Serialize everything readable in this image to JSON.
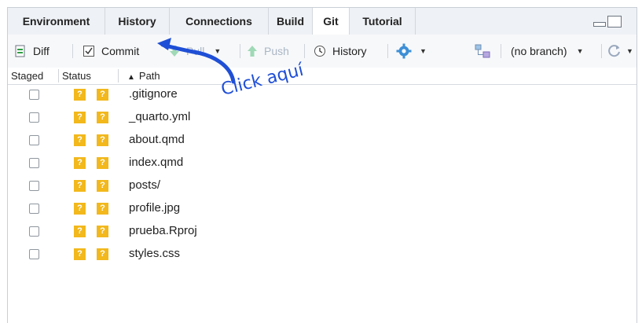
{
  "tabs": [
    {
      "label": "Environment",
      "active": false
    },
    {
      "label": "History",
      "active": false
    },
    {
      "label": "Connections",
      "active": false
    },
    {
      "label": "Build",
      "active": false
    },
    {
      "label": "Git",
      "active": true
    },
    {
      "label": "Tutorial",
      "active": false
    }
  ],
  "toolbar": {
    "diff_label": "Diff",
    "commit_label": "Commit",
    "pull_label": "Pull",
    "push_label": "Push",
    "history_label": "History",
    "branch_label": "(no branch)"
  },
  "columns": {
    "staged": "Staged",
    "status": "Status",
    "path": "Path",
    "sort_indicator": "▲"
  },
  "status_glyph": "?",
  "files": [
    ".gitignore",
    "_quarto.yml",
    "about.qmd",
    "index.qmd",
    "posts/",
    "profile.jpg",
    "prueba.Rproj",
    "styles.css"
  ],
  "annotation": {
    "text": "Click aquí",
    "color": "#1f4fd6"
  },
  "colors": {
    "status_badge": "#f2b81c",
    "tab_bar": "#eef1f5",
    "toolbar": "#f7f8fa",
    "border": "#c9ced6"
  }
}
